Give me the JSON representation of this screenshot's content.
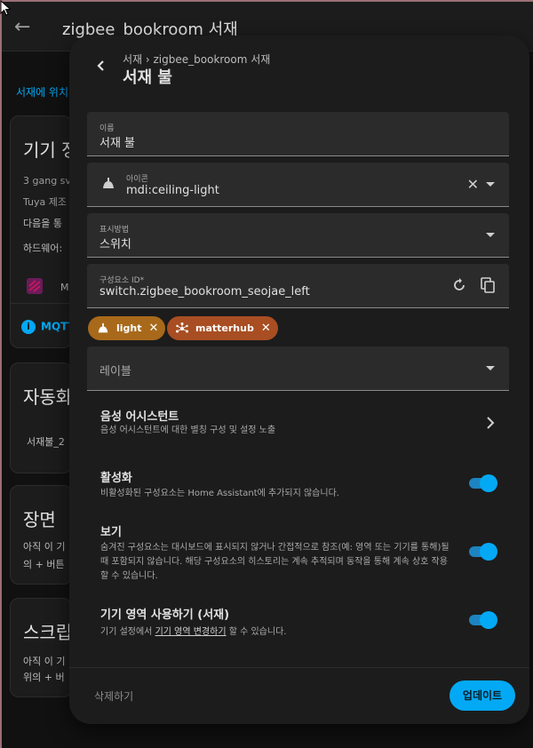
{
  "background": {
    "title": "zigbee_bookroom 서재",
    "link": "서재에 위치",
    "device_card": {
      "heading": "기기 정",
      "line1": "3 gang sv",
      "line2": "Tuya 제조",
      "line3": "다음을 통",
      "line4": "하드웨어:",
      "line5": "M",
      "mqtt": "MQTT"
    },
    "automation_card": {
      "heading": "자동화",
      "item": "서재불_2"
    },
    "scene_card": {
      "heading": "장면",
      "line1": "아직 이 기",
      "line2": "의 + 버튼"
    },
    "script_card": {
      "heading": "스크립",
      "line1": "아직 이 기",
      "line2": "위의 + 버"
    }
  },
  "dialog": {
    "breadcrumb": "서재 › zigbee_bookroom 서재",
    "title": "서재 불",
    "name_field": {
      "label": "이름",
      "value": "서재 불"
    },
    "icon_field": {
      "label": "아이콘",
      "value": "mdi:ceiling-light"
    },
    "display_field": {
      "label": "표시방법",
      "value": "스위치"
    },
    "entity_id_field": {
      "label": "구성요소 ID*",
      "value": "switch.zigbee_bookroom_seojae_left"
    },
    "chips": [
      {
        "label": "light",
        "color": "#a8691a"
      },
      {
        "label": "matterhub",
        "color": "#a84e22"
      }
    ],
    "labels_field": {
      "placeholder": "레이블"
    },
    "voice": {
      "title": "음성 어시스턴트",
      "desc": "음성 어시스턴트에 대한 별칭 구성 및 설정 노출"
    },
    "enabled": {
      "title": "활성화",
      "desc": "비활성화된 구성요소는 Home Assistant에 추가되지 않습니다.",
      "on": true
    },
    "visible": {
      "title": "보기",
      "desc_line1": "숨겨진 구성요소는 대시보드에 표시되지 않거나 간접적으로 참조(예: 영역 또는 기기를 통해)될",
      "desc_line2": "때 포함되지 않습니다. 해당 구성요소의 히스토리는 계속 추적되며 동작을 통해 계속 상호 작용",
      "desc_line3": "할 수 있습니다.",
      "on": true
    },
    "area": {
      "title": "기기 영역 사용하기 (서재)",
      "desc_pre": "기기 설정에서 ",
      "desc_link": "기기 영역 변경하기",
      "desc_post": " 할 수 있습니다.",
      "on": true
    },
    "delete_label": "삭제하기",
    "update_label": "업데이트",
    "accent_color": "#03a9f4"
  }
}
